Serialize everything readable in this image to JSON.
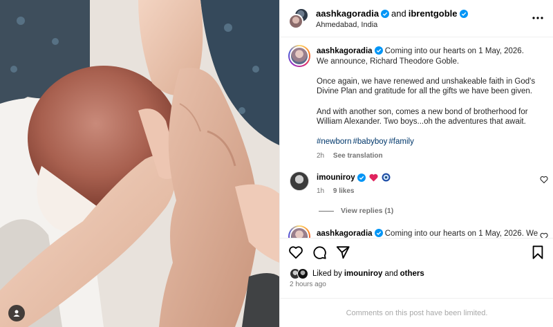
{
  "post": {
    "author": "aashkagoradia",
    "collab_and": "and",
    "collaborator": "ibrentgoble",
    "location": "Ahmedabad, India",
    "more_icon": "more-horizontal-icon"
  },
  "caption": {
    "username": "aashkagoradia",
    "text_1": "Coming into our hearts on 1 May, 2026. We announce, Richard Theodore Goble.",
    "text_2": "Once again, we have renewed and unshakeable faith in God's Divine Plan and gratitude for all the gifts we have been given.",
    "text_3": "And with another son, comes a new bond of brotherhood for William Alexander. Two boys...oh the adventures that await.",
    "hashtags": [
      "#newborn",
      "#babyboy",
      "#family"
    ],
    "time": "2h",
    "see_translation": "See translation"
  },
  "comments": [
    {
      "username": "imouniroy",
      "emojis": [
        "heart-emoji",
        "nazar-emoji"
      ],
      "time": "1h",
      "likes": "9 likes",
      "view_replies": "View replies (1)"
    },
    {
      "username": "aashkagoradia",
      "text": "Coming into our hearts on 1 May, 2026. We"
    }
  ],
  "actions": {
    "like_icon": "heart-icon",
    "comment_icon": "comment-icon",
    "share_icon": "share-icon",
    "save_icon": "bookmark-icon"
  },
  "likes": {
    "prefix": "Liked by",
    "user": "imouniroy",
    "and": "and",
    "others": "others"
  },
  "timestamp": "2 hours ago",
  "comments_limited": "Comments on this post have been limited.",
  "colors": {
    "verified": "#0095f6",
    "hashtag": "#00376b",
    "muted": "#737373",
    "heart_red": "#e0245e"
  }
}
